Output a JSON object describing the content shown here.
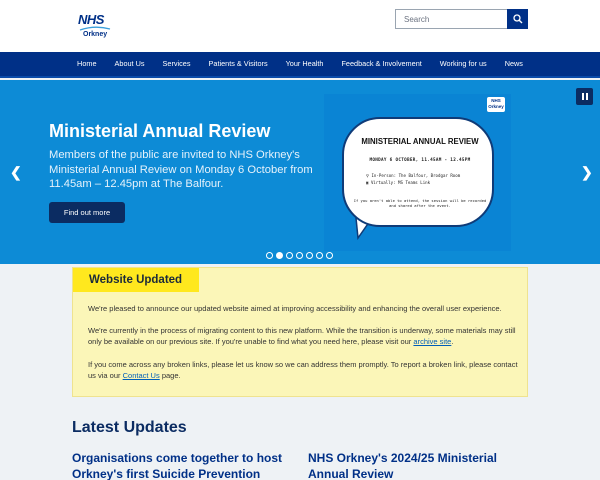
{
  "header": {
    "logo": {
      "brand": "NHS",
      "subtitle": "Orkney"
    },
    "search": {
      "placeholder": "Search",
      "icon": "search-icon"
    }
  },
  "nav": {
    "items": [
      "Home",
      "About Us",
      "Services",
      "Patients & Visitors",
      "Your Health",
      "Feedback & Involvement",
      "Working for us",
      "News"
    ]
  },
  "hero": {
    "title": "Ministerial Annual Review",
    "text": "Members of the public are invited to NHS Orkney's Ministerial Annual Review on Monday 6 October from 11.45am – 12.45pm at The Balfour.",
    "cta_label": "Find out more",
    "pause_icon": "pause-icon",
    "prev_icon": "chevron-left-icon",
    "next_icon": "chevron-right-icon",
    "poster": {
      "logo_text": "NHS Orkney",
      "title": "MINISTERIAL ANNUAL REVIEW",
      "date": "MONDAY 6 OCTOBER, 11.45AM - 12.45PM",
      "line1": "In-Person: The Balfour, Brodgar Room",
      "line2": "Virtually: MS Teams Link",
      "note": "If you aren't able to attend, the session will be recorded and shared after the event."
    },
    "slide_count": 7,
    "active_slide": 2
  },
  "notice": {
    "heading": "Website Updated",
    "p1": "We're pleased to announce our updated website aimed at improving accessibility and enhancing the overall user experience.",
    "p2_text": "We're currently in the process of migrating content to this new platform. While the transition is underway, some materials may still only be available on our previous site. If you're unable to find what you need here, please visit our",
    "p2_link": "archive site",
    "p2_end": ".",
    "p3_text": "If you come across any broken links, please let us know so we can address them promptly. To report a broken link, please contact us via our",
    "p3_link": "Contact Us",
    "p3_end": " page."
  },
  "latest": {
    "title": "Latest Updates",
    "cards": [
      {
        "title": "Organisations come together to host Orkney's first Suicide Prevention"
      },
      {
        "title": "NHS Orkney's 2024/25 Ministerial Annual Review"
      }
    ]
  },
  "colors": {
    "nhs_blue": "#003087",
    "hero_blue": "#0d8bd6",
    "notice_bg": "#fbf6b8",
    "notice_heading_bg": "#ffe81e"
  }
}
